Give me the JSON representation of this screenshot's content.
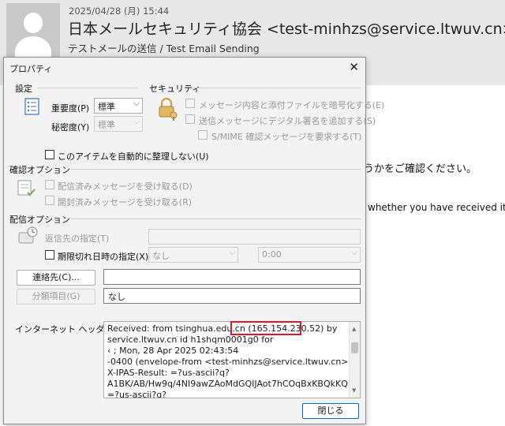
{
  "mail": {
    "date": "2025/04/28 (月) 15:44",
    "from": "日本メールセキュリティ協会 <test-minhzs@service.ltwuv.cn>",
    "subject": "テストメールの送信 / Test Email Sending",
    "body_ja_fragment": "うかをご確認ください。",
    "body_en_fragment": "whether you have received it."
  },
  "dialog": {
    "title": "プロパティ",
    "close_glyph": "✕",
    "settings": {
      "heading": "設定",
      "importance_label": "重要度(P)",
      "importance_value": "標準",
      "sensitivity_label": "秘密度(Y)",
      "sensitivity_value": "標準",
      "no_archive_label": "このアイテムを自動的に整理しない(U)"
    },
    "security": {
      "heading": "セキュリティ",
      "encrypt_label": "メッセージ内容と添付ファイルを暗号化する(E)",
      "signature_label": "送信メッセージにデジタル署名を追加する(S)",
      "smime_label": "S/MIME 確認メッセージを要求する(T)"
    },
    "tracking": {
      "heading": "確認オプション",
      "delivery_label": "配信済みメッセージを受け取る(D)",
      "read_label": "開封済みメッセージを受け取る(R)"
    },
    "delivery": {
      "heading": "配信オプション",
      "reply_to_label": "返信先の指定(T)",
      "expires_label": "期限切れ日時の指定(X)",
      "expires_date": "なし",
      "expires_time": "0:00"
    },
    "contacts_button": "連絡先(C)...",
    "categories_button": "分類項目(G)",
    "categories_value": "なし",
    "internet_headers_label": "インターネット ヘッダー(H)",
    "internet_headers_lines": [
      "Received: from tsinghua.edu.cn (165.154.230.52) by",
      "service.ltwuv.cn id h1shqm0001g0 for",
      "‹                                    ; Mon, 28 Apr 2025 02:43:54",
      "-0400 (envelope-from <test-minhzs@service.ltwuv.cn>)",
      "X-IPAS-Result: =?us-ascii?q?",
      "A1BK/AB/Hw9q/4NI9awZAoMdGQIJAot7hCOqBxKBQkKQP?=",
      " =?us-ascii?q?"
    ],
    "close_button": "閉じる"
  },
  "colors": {
    "highlight_border": "#d21f2b",
    "primary_button_border": "#0067c0"
  },
  "icons": [
    "avatar-person-icon",
    "properties-settings-icon",
    "security-lock-icon",
    "tracking-icon",
    "delivery-options-icon"
  ]
}
